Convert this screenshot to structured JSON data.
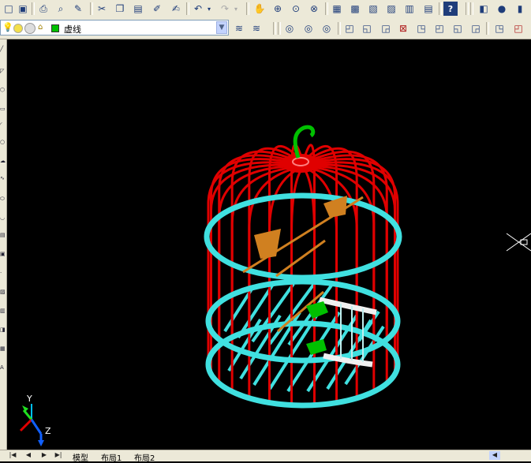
{
  "toolbar_standard": {
    "icons": [
      "new-icon",
      "save-icon",
      "print-icon",
      "plot-preview-icon",
      "publish-icon",
      "cut-icon",
      "copy-icon",
      "paste-icon",
      "match-properties-icon",
      "block-editor-icon",
      "undo-icon",
      "redo-icon",
      "pan-icon",
      "zoom-realtime-icon",
      "zoom-window-icon",
      "zoom-previous-icon",
      "properties-icon",
      "design-center-icon",
      "tool-palettes-icon",
      "sheet-set-icon",
      "markup-icon",
      "calculator-icon",
      "help-icon",
      "box-icon",
      "sphere-icon",
      "cylinder-icon"
    ]
  },
  "layer_bar": {
    "current_layer": "虚线",
    "layer_color": "#00c000"
  },
  "toolbar_3d": {
    "icons": [
      "layer-previous-icon",
      "layer-state-icon",
      "layer-manager-icon",
      "orbit-icon",
      "constrained-orbit-icon",
      "free-orbit-icon",
      "view-top-icon",
      "view-bottom-icon",
      "view-left-icon",
      "view-right-icon",
      "view-front-icon",
      "view-back-icon",
      "view-sw-iso-icon",
      "view-se-iso-icon",
      "view-ne-iso-icon",
      "view-nw-iso-icon"
    ]
  },
  "ucs": {
    "y_label": "Y",
    "z_label": "Z"
  },
  "layout_tabs": {
    "model": "模型",
    "layout1": "布局1",
    "layout2": "布局2"
  },
  "colors": {
    "cage_bars": "#e00000",
    "cage_rings": "#40e0e0",
    "hook": "#00c000",
    "perch": "#f0f0f0",
    "feeder": "#d08020",
    "background": "#000000"
  }
}
